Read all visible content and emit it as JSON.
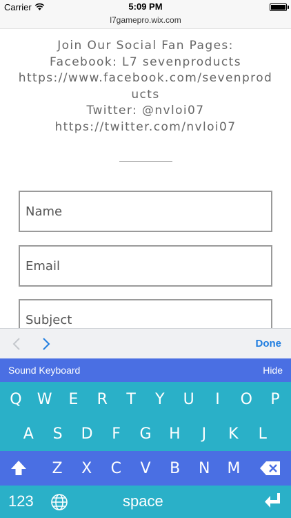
{
  "status_bar": {
    "carrier": "Carrier",
    "time": "5:09 PM"
  },
  "browser": {
    "url": "l7gamepro.wix.com"
  },
  "social": {
    "lines": [
      "Join Our Social Fan Pages:",
      "Facebook: L7 sevenproducts",
      "https://www.facebook.com/sevenprod",
      "ucts",
      "Twitter: @nvloi07",
      "https://twitter.com/nvloi07"
    ]
  },
  "form": {
    "name_placeholder": "Name",
    "email_placeholder": "Email",
    "subject_placeholder": "Subject"
  },
  "accessory": {
    "done_label": "Done"
  },
  "keyboard": {
    "title": "Sound Keyboard",
    "hide_label": "Hide",
    "row1": [
      "Q",
      "W",
      "E",
      "R",
      "T",
      "Y",
      "U",
      "I",
      "O",
      "P"
    ],
    "row2": [
      "A",
      "S",
      "D",
      "F",
      "G",
      "H",
      "J",
      "K",
      "L"
    ],
    "row3": [
      "Z",
      "X",
      "C",
      "V",
      "B",
      "N",
      "M"
    ],
    "numbers_label": "123",
    "space_label": "space",
    "colors": {
      "blue": "#4a6fe3",
      "teal": "#2ab0c8"
    }
  }
}
